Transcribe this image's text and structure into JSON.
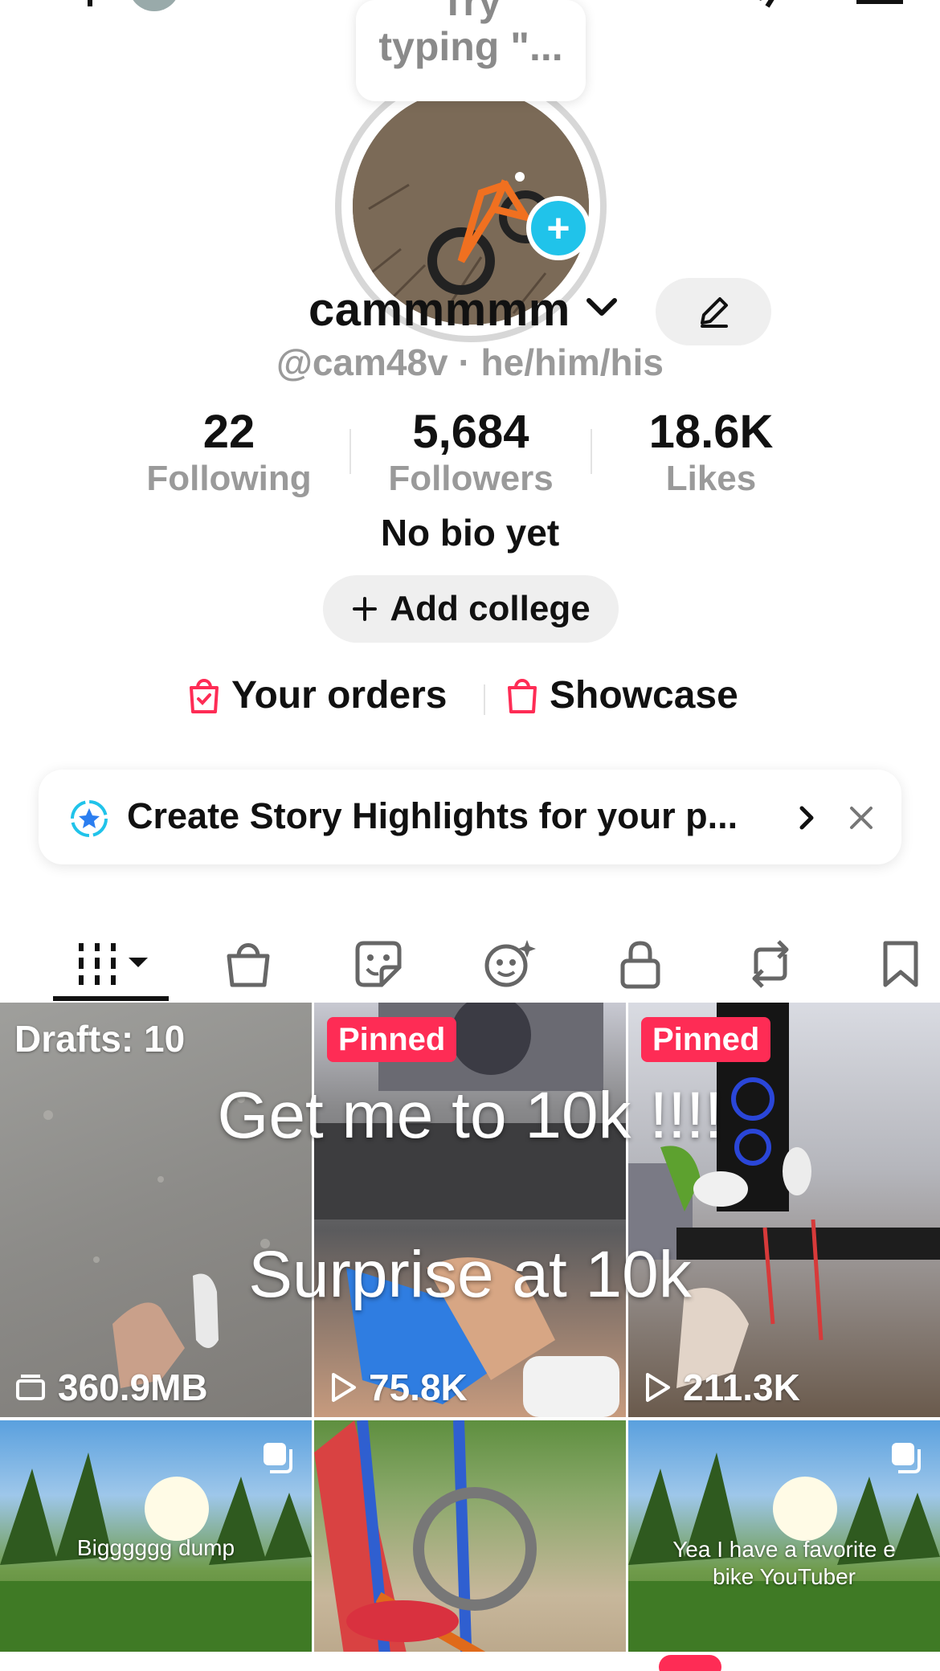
{
  "tooltip": {
    "line1": "Try",
    "line2": "typing \"..."
  },
  "profile": {
    "display_name": "cammmmm",
    "handle_line": "@cam48v · he/him/his",
    "bio": "No bio yet"
  },
  "stats": [
    {
      "value": "22",
      "label": "Following"
    },
    {
      "value": "5,684",
      "label": "Followers"
    },
    {
      "value": "18.6K",
      "label": "Likes"
    }
  ],
  "actions": {
    "add_college": "Add college",
    "your_orders": "Your orders",
    "showcase": "Showcase"
  },
  "story_prompt": {
    "text": "Create Story Highlights for your p..."
  },
  "tabs": [
    {
      "name": "videos-tab-icon"
    },
    {
      "name": "shop-tab-icon"
    },
    {
      "name": "sticker-tab-icon"
    },
    {
      "name": "ai-self-tab-icon"
    },
    {
      "name": "private-tab-icon"
    },
    {
      "name": "reposts-tab-icon"
    },
    {
      "name": "favorites-tab-icon"
    }
  ],
  "grid": {
    "overlay_caption_1": "Get me to 10k !!!!",
    "overlay_caption_2": "Surprise at 10k",
    "cells": [
      {
        "badge": "Drafts: 10",
        "count": "360.9MB",
        "count_icon": "storage-icon"
      },
      {
        "badge": "Pinned",
        "count": "75.8K",
        "count_icon": "play-icon"
      },
      {
        "badge": "Pinned",
        "count": "211.3K",
        "count_icon": "play-icon"
      },
      {
        "caption": "Bigggggg dump",
        "icon": "multi-photo-icon"
      },
      {
        "caption": ""
      },
      {
        "caption": "Yea I have a favorite e bike YouTuber",
        "icon": "multi-photo-icon"
      }
    ]
  },
  "colors": {
    "accent_red": "#fe2c55",
    "accent_cyan": "#20c3ea",
    "muted_text": "#9a9a9a"
  }
}
